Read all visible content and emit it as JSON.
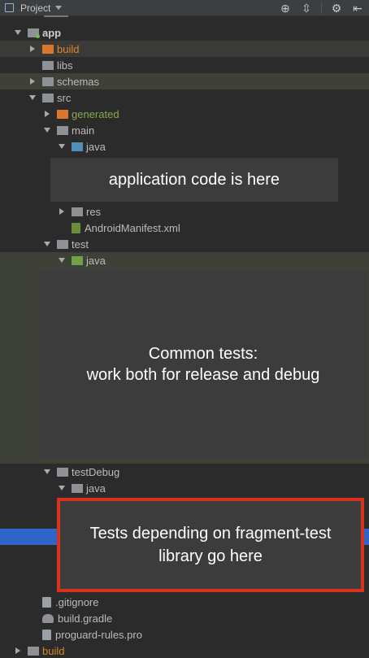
{
  "toolbar": {
    "title": "Project",
    "icons": [
      "target-icon",
      "collapse-icon",
      "gear-icon",
      "hide-icon"
    ]
  },
  "tree": [
    {
      "label": "app",
      "icon": "folder-module",
      "expanded": true,
      "style": "bold"
    },
    {
      "label": "build",
      "icon": "folder-orange",
      "expanded": false,
      "style": "orange"
    },
    {
      "label": "libs",
      "icon": "folder-gray",
      "expanded": null
    },
    {
      "label": "schemas",
      "icon": "folder-gray",
      "expanded": false
    },
    {
      "label": "src",
      "icon": "folder-gray",
      "expanded": true
    },
    {
      "label": "generated",
      "icon": "folder-orange",
      "expanded": false,
      "style": "green"
    },
    {
      "label": "main",
      "icon": "folder-gray",
      "expanded": true
    },
    {
      "label": "java",
      "icon": "folder-blue",
      "expanded": true
    },
    {
      "label": "res",
      "icon": "folder-res",
      "expanded": false
    },
    {
      "label": "AndroidManifest.xml",
      "icon": "manifest-file"
    },
    {
      "label": "test",
      "icon": "folder-gray",
      "expanded": true
    },
    {
      "label": "java",
      "icon": "folder-green",
      "expanded": true
    },
    {
      "label": "testDebug",
      "icon": "folder-gray",
      "expanded": true
    },
    {
      "label": "java",
      "icon": "folder-green",
      "expanded": true
    },
    {
      "label": ".gitignore",
      "icon": "file"
    },
    {
      "label": "build.gradle",
      "icon": "gradle-file"
    },
    {
      "label": "proguard-rules.pro",
      "icon": "file"
    },
    {
      "label": "build",
      "icon": "folder-orange",
      "expanded": false,
      "style": "orange"
    }
  ],
  "callouts": {
    "main": "application code is here",
    "common": "Common tests:\nwork both for release and debug",
    "debug": "Tests depending on fragment-test\nlibrary go here"
  },
  "colors": {
    "background": "#2b2b2b",
    "selection": "#2f65ca",
    "highlight": "#d8321e",
    "callout_bg": "#3c3c3c"
  }
}
